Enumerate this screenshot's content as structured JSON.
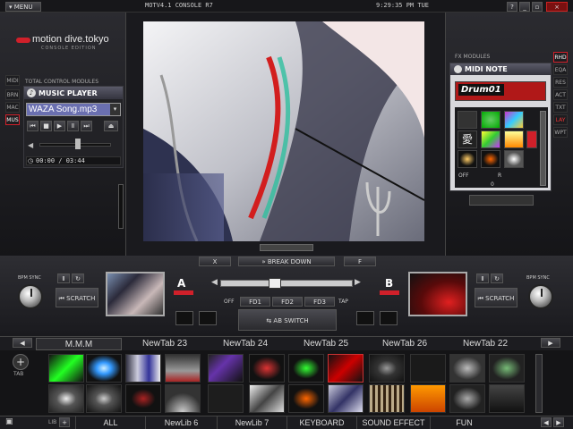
{
  "topbar": {
    "menu": "MENU",
    "console_title": "MOTV4.1 CONSOLE R7",
    "clock": "9:29:35 PM TUE",
    "window_controls": [
      "?",
      "_",
      "▫",
      "×"
    ]
  },
  "brand": {
    "name": "motion dive.tokyo",
    "edition": "CONSOLE EDITION"
  },
  "left_side_tabs": [
    "MIDI",
    "BRN",
    "MAC",
    "MUS"
  ],
  "total_control": {
    "heading": "TOTAL CONTROL MODULES",
    "player_title": "MUSIC PLAYER",
    "song": "WAZA Song.mp3",
    "time": "00:00 / 03:44"
  },
  "fx": {
    "heading": "FX MODULES",
    "module_title": "MIDI NOTE",
    "preset": "Drum01",
    "off_label": "OFF",
    "off_value": "0",
    "r_label": "R"
  },
  "right_side_tabs": [
    "RHD",
    "EQA",
    "RES",
    "ACT",
    "TXT",
    "LAY",
    "WPT"
  ],
  "mixer": {
    "x_label": "X",
    "break_down": "BREAK DOWN",
    "f_label": "F",
    "deck_a": "A",
    "deck_b": "B",
    "off": "OFF",
    "fd1": "FD1",
    "fd2": "FD2",
    "fd3": "FD3",
    "tap": "TAP",
    "ab_switch": "AB SWITCH",
    "bpm_sync": "BPM SYNC",
    "scratch": "SCRATCH",
    "crossfade": 0.5
  },
  "tabs": [
    "M.M.M",
    "NewTab 23",
    "NewTab 24",
    "NewTab 25",
    "NewTab 26",
    "NewTab 22"
  ],
  "tab_side": "TAB",
  "lib_bar": {
    "lib": "LIB",
    "items": [
      "ALL",
      "NewLib 6",
      "NewLib 7",
      "KEYBOARD",
      "SOUND EFFECT",
      "FUN"
    ]
  },
  "colors": {
    "accent": "#d0202a",
    "panel": "#25252a",
    "dark": "#0c0c0e"
  }
}
